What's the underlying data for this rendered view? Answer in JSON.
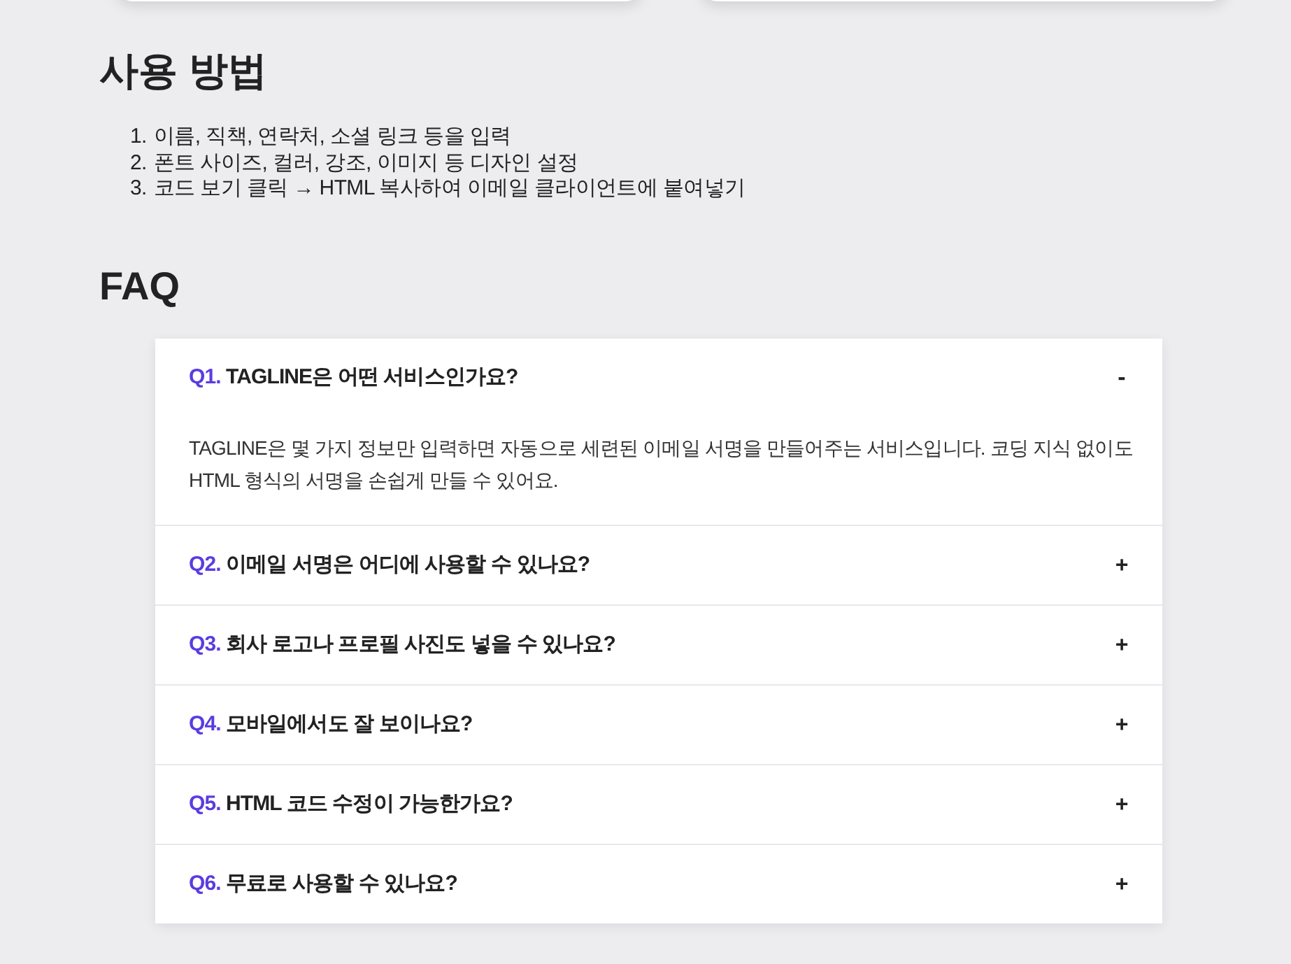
{
  "top_cards": [
    {
      "kind": "card"
    },
    {
      "kind": "card"
    }
  ],
  "usage": {
    "title": "사용 방법",
    "steps": [
      {
        "number": "1.",
        "text": "이름, 직책, 연락처, 소셜 링크 등을 입력"
      },
      {
        "number": "2.",
        "text": "폰트 사이즈, 컬러, 강조, 이미지 등 디자인 설정"
      },
      {
        "number": "3.",
        "text": "코드 보기 클릭 → HTML 복사하여 이메일 클라이언트에 붙여넣기"
      }
    ]
  },
  "faq": {
    "title": "FAQ",
    "items": [
      {
        "number": "Q1.",
        "question": "TAGLINE은 어떤 서비스인가요?",
        "toggle": "-",
        "expanded": true,
        "answer": "TAGLINE은 몇 가지 정보만 입력하면 자동으로 세련된 이메일 서명을 만들어주는 서비스입니다. 코딩 지식 없이도 HTML 형식의 서명을 손쉽게 만들 수 있어요."
      },
      {
        "number": "Q2.",
        "question": "이메일 서명은 어디에 사용할 수 있나요?",
        "toggle": "+",
        "expanded": false
      },
      {
        "number": "Q3.",
        "question": "회사 로고나 프로필 사진도 넣을 수 있나요?",
        "toggle": "+",
        "expanded": false
      },
      {
        "number": "Q4.",
        "question": "모바일에서도 잘 보이나요?",
        "toggle": "+",
        "expanded": false
      },
      {
        "number": "Q5.",
        "question": "HTML 코드 수정이 가능한가요?",
        "toggle": "+",
        "expanded": false
      },
      {
        "number": "Q6.",
        "question": "무료로 사용할 수 있나요?",
        "toggle": "+",
        "expanded": false
      }
    ]
  }
}
